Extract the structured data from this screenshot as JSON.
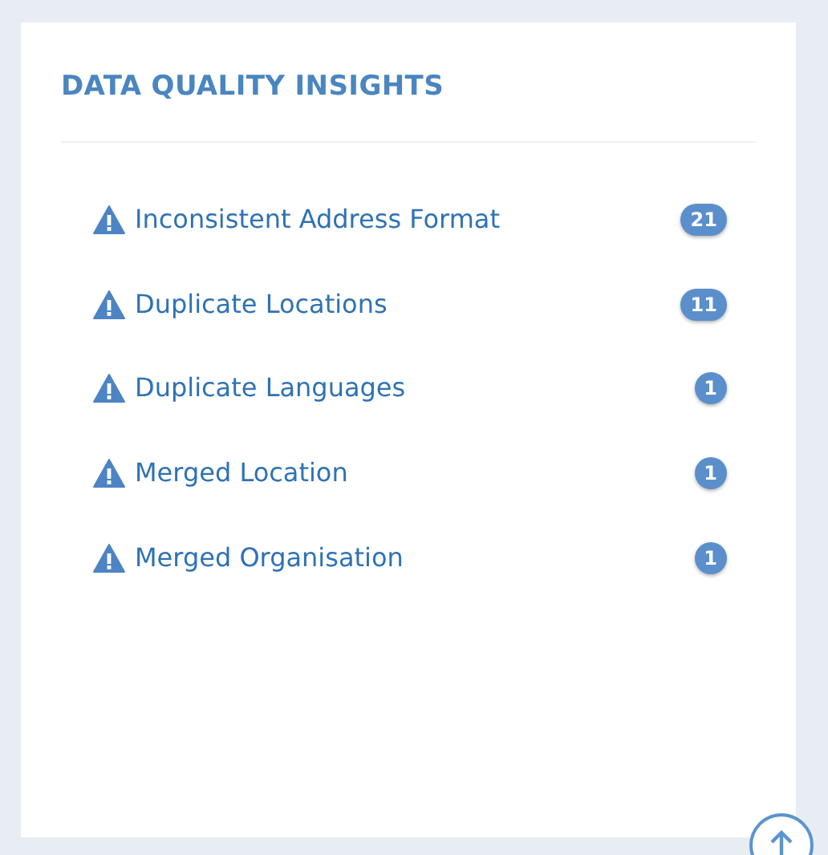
{
  "title": "DATA QUALITY INSIGHTS",
  "items": [
    {
      "label": "Inconsistent Address Format",
      "count": "21"
    },
    {
      "label": "Duplicate Locations",
      "count": "11"
    },
    {
      "label": "Duplicate Languages",
      "count": "1"
    },
    {
      "label": "Merged Location",
      "count": "1"
    },
    {
      "label": "Merged Organisation",
      "count": "1"
    }
  ]
}
